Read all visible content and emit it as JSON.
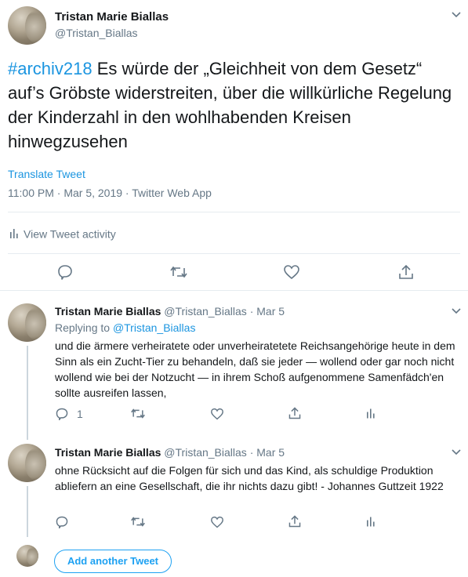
{
  "main": {
    "author_name": "Tristan Marie Biallas",
    "author_handle": "@Tristan_Biallas",
    "hashtag": "#archiv218",
    "text": " Es würde der „Gleichheit von dem Gesetz“ auf’s Gröbste widerstreiten, über die willkürliche Regelung der Kinderzahl in den wohlhabenden Kreisen hinwegzusehen",
    "translate": "Translate Tweet",
    "meta": "11:00 PM · Mar 5, 2019 · Twitter Web App",
    "activity": "View Tweet activity"
  },
  "replies": [
    {
      "name": "Tristan Marie Biallas",
      "handle": "@Tristan_Biallas",
      "date": "· Mar 5",
      "replying_prefix": "Replying to ",
      "replying_to": "@Tristan_Biallas",
      "text": "und die ärmere verheiratete oder unverheiratetete Reichsangehörige heute in dem Sinn als ein Zucht-Tier zu behandeln, daß sie jeder — wollend oder gar noch nicht wollend wie bei der Notzucht — in ihrem Schoß aufgenommene Samenfädch'en sollte ausreifen lassen,",
      "reply_count": "1"
    },
    {
      "name": "Tristan Marie Biallas",
      "handle": "@Tristan_Biallas",
      "date": "· Mar 5",
      "text": "ohne Rücksicht auf die Folgen für sich und das Kind, als schuldige Produktion abliefern an eine Gesellschaft, die ihr nichts dazu gibt! - Johannes Guttzeit 1922",
      "reply_count": ""
    }
  ],
  "compose": {
    "add_button": "Add another Tweet"
  },
  "colors": {
    "accent": "#1da1f2",
    "link": "#1b95e0",
    "muted": "#657786",
    "divider": "#e6ecf0"
  }
}
